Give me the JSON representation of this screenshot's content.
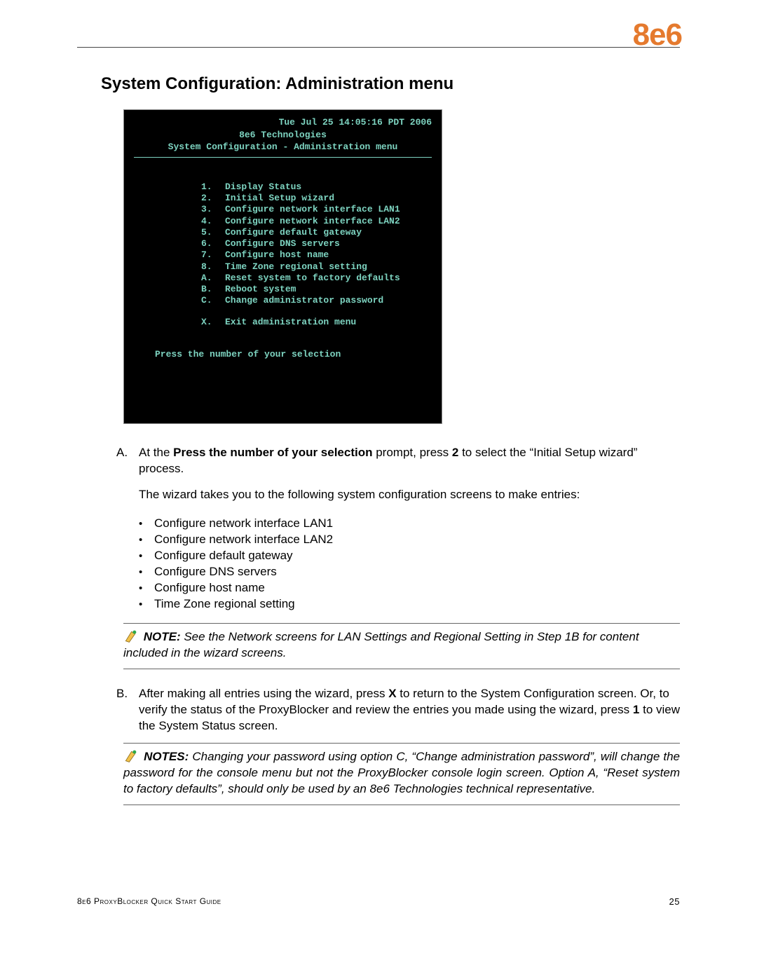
{
  "logo": "8e6",
  "section_title": "System Configuration: Administration menu",
  "terminal": {
    "date": "Tue Jul 25 14:05:16 PDT 2006",
    "title1": "8e6 Technologies",
    "title2": "System Configuration - Administration menu",
    "menu": [
      {
        "k": "1.",
        "v": "Display Status"
      },
      {
        "k": "2.",
        "v": "Initial Setup wizard"
      },
      {
        "k": "3.",
        "v": "Configure network interface LAN1"
      },
      {
        "k": "4.",
        "v": "Configure network interface LAN2"
      },
      {
        "k": "5.",
        "v": "Configure default gateway"
      },
      {
        "k": "6.",
        "v": "Configure DNS servers"
      },
      {
        "k": "7.",
        "v": "Configure host name"
      },
      {
        "k": "8.",
        "v": "Time Zone regional setting"
      },
      {
        "k": "A.",
        "v": "Reset system to factory defaults"
      },
      {
        "k": "B.",
        "v": "Reboot system"
      },
      {
        "k": "C.",
        "v": "Change administrator password"
      }
    ],
    "exit": {
      "k": "X.",
      "v": "Exit administration menu"
    },
    "prompt": "Press the number of your selection"
  },
  "stepA": {
    "label": "A.",
    "parts": [
      "At the ",
      "Press the number of your selection",
      " prompt, press ",
      "2",
      " to select the “Initial Setup wizard” process."
    ]
  },
  "para2": "The wizard takes you to the following system configuration screens to make entries:",
  "bullets": [
    "Configure network interface LAN1",
    "Configure network interface LAN2",
    "Configure default gateway",
    "Configure DNS servers",
    "Configure host name",
    "Time Zone regional setting"
  ],
  "note1": {
    "label": "NOTE:",
    "text": " See the Network screens for LAN Settings and Regional Setting in Step 1B for content included in the wizard screens."
  },
  "stepB": {
    "label": "B.",
    "parts": [
      "After making all entries using the wizard, press ",
      "X",
      " to return to the System Configuration screen. Or, to verify the status of the ProxyBlocker and review the entries you made using the wizard, press ",
      "1",
      " to view the System Status screen."
    ]
  },
  "note2": {
    "label": "NOTES:",
    "text": " Changing your password using option C, “Change administration password”, will change the password for the console menu but not the ProxyBlocker console login screen. Option A, “Reset system to factory defaults”, should only be used by an 8e6 Technologies technical representative."
  },
  "footer_left": "8e6 ProxyBlocker Quick Start Guide",
  "footer_page": "25"
}
